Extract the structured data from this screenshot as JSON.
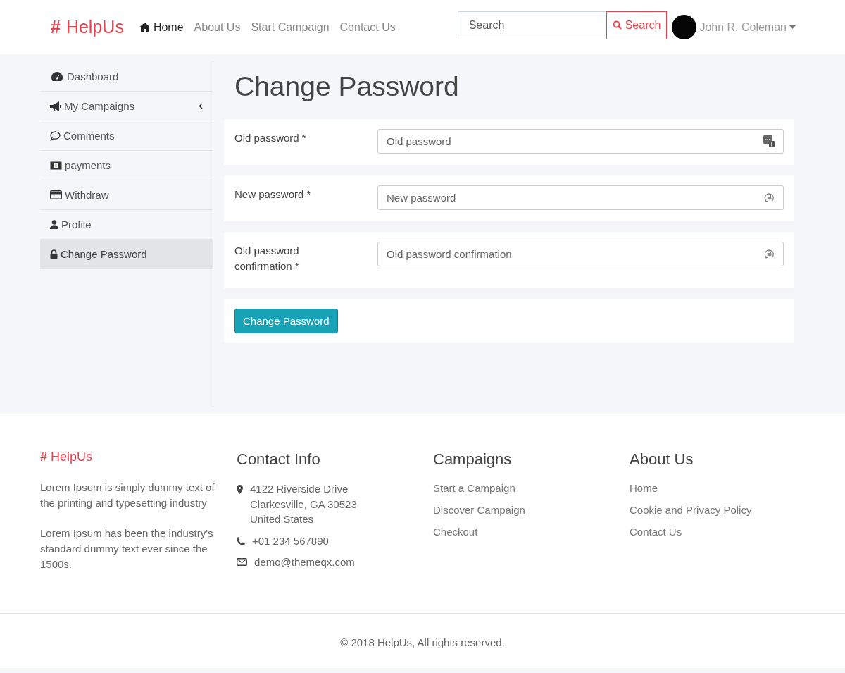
{
  "header": {
    "logo_mark": "#",
    "logo_text": "HelpUs",
    "nav": [
      {
        "label": "Home",
        "selected": true,
        "kind": "home"
      },
      {
        "label": "About Us",
        "selected": false,
        "kind": "plain"
      },
      {
        "label": "Start Campaign",
        "selected": false,
        "kind": "plain"
      },
      {
        "label": "Contact Us",
        "selected": false,
        "kind": "plain"
      }
    ],
    "search": {
      "placeholder": "Search",
      "button": "Search"
    },
    "user": {
      "name": "John R. Coleman"
    }
  },
  "sidebar": {
    "items": [
      {
        "label": "Dashboard",
        "kind": "dashboard",
        "selected": false,
        "expandable": false
      },
      {
        "label": "My Campaigns",
        "kind": "campaigns",
        "selected": false,
        "expandable": true
      },
      {
        "label": "Comments",
        "kind": "comments",
        "selected": false,
        "expandable": false
      },
      {
        "label": "payments",
        "kind": "payments",
        "selected": false,
        "expandable": false
      },
      {
        "label": "Withdraw",
        "kind": "withdraw",
        "selected": false,
        "expandable": false
      },
      {
        "label": "Profile",
        "kind": "profile",
        "selected": false,
        "expandable": false
      },
      {
        "label": "Change Password",
        "kind": "password",
        "selected": true,
        "expandable": false
      }
    ]
  },
  "page": {
    "title": "Change Password",
    "fields": [
      {
        "label": "Old password *",
        "placeholder": "Old password",
        "kind": "current"
      },
      {
        "label": "New password *",
        "placeholder": "New password",
        "kind": "renew"
      },
      {
        "label": "Old password confirmation *",
        "placeholder": "Old password confirmation",
        "kind": "renew"
      }
    ],
    "submit": "Change Password"
  },
  "footer": {
    "logo_mark": "#",
    "logo_text": "HelpUs",
    "paragraphs": [
      "Lorem Ipsum is simply dummy text of the printing and typesetting industry",
      "Lorem Ipsum has been the industry's standard dummy text ever since the 1500s."
    ],
    "contact": {
      "title": "Contact Info",
      "items": [
        {
          "kind": "address",
          "lines": [
            "4122 Riverside Drive",
            "Clarkesville, GA 30523",
            "United States"
          ]
        },
        {
          "kind": "phone",
          "lines": [
            "+01 234 567890"
          ]
        },
        {
          "kind": "email",
          "lines": [
            "demo@themeqx.com"
          ]
        }
      ]
    },
    "campaigns": {
      "title": "Campaigns",
      "links": [
        "Start a Campaign",
        "Discover Campaign",
        "Checkout"
      ]
    },
    "about": {
      "title": "About Us",
      "links": [
        "Home",
        "Cookie and Privacy Policy",
        "Contact Us"
      ]
    },
    "copyright": "© 2018 HelpUs, All rights reserved."
  }
}
